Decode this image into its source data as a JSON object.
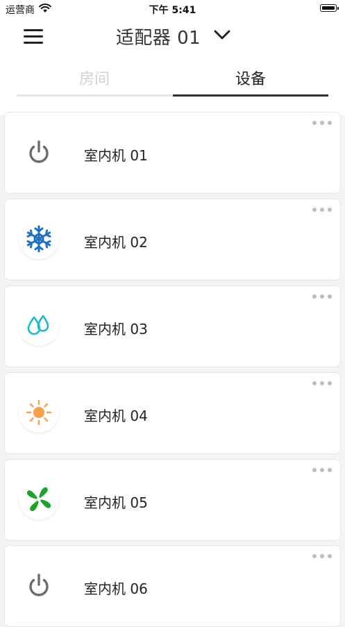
{
  "status_bar": {
    "carrier": "运营商",
    "time": "下午 5:41"
  },
  "header": {
    "title": "适配器 01"
  },
  "tabs": [
    {
      "label": "房间",
      "active": false
    },
    {
      "label": "设备",
      "active": true
    }
  ],
  "colors": {
    "power": "#6b6b6b",
    "cool": "#1d6fc4",
    "dry": "#1eb8c8",
    "heat": "#f6a04d",
    "fan": "#1fa22a"
  },
  "devices": [
    {
      "name": "室内机 01",
      "mode_icon": "power-icon"
    },
    {
      "name": "室内机 02",
      "mode_icon": "snowflake-icon"
    },
    {
      "name": "室内机 03",
      "mode_icon": "water-drop-icon"
    },
    {
      "name": "室内机 04",
      "mode_icon": "sun-icon"
    },
    {
      "name": "室内机 05",
      "mode_icon": "fan-icon"
    },
    {
      "name": "室内机 06",
      "mode_icon": "power-icon"
    }
  ]
}
